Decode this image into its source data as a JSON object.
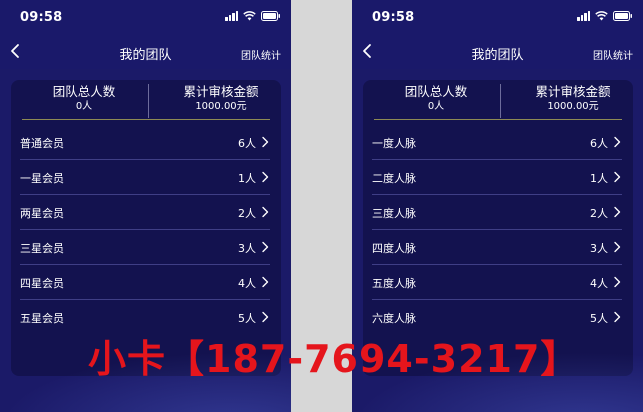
{
  "status": {
    "time": "09:58"
  },
  "nav": {
    "title": "我的团队",
    "action": "团队统计"
  },
  "summary": {
    "members_label": "团队总人数",
    "members_value": "0人",
    "amount_label": "累计审核金额",
    "amount_value": "1000.00元"
  },
  "left_list": [
    {
      "label": "普通会员",
      "count": "6人"
    },
    {
      "label": "一星会员",
      "count": "1人"
    },
    {
      "label": "两星会员",
      "count": "2人"
    },
    {
      "label": "三星会员",
      "count": "3人"
    },
    {
      "label": "四星会员",
      "count": "4人"
    },
    {
      "label": "五星会员",
      "count": "5人"
    }
  ],
  "right_list": [
    {
      "label": "一度人脉",
      "count": "6人"
    },
    {
      "label": "二度人脉",
      "count": "1人"
    },
    {
      "label": "三度人脉",
      "count": "2人"
    },
    {
      "label": "四度人脉",
      "count": "3人"
    },
    {
      "label": "五度人脉",
      "count": "4人"
    },
    {
      "label": "六度人脉",
      "count": "5人"
    }
  ],
  "watermark": "小卡【187-7694-3217】",
  "icons": {
    "signal": "cellular-signal-icon",
    "wifi": "wifi-icon",
    "battery": "battery-icon",
    "back": "back-chevron-icon",
    "row": "chevron-right-icon"
  },
  "colors": {
    "background": "#1b1a68",
    "card": "#13124f",
    "divider_accent": "#8d8a54",
    "watermark": "#e5151c",
    "gap": "#d7d7d7"
  }
}
